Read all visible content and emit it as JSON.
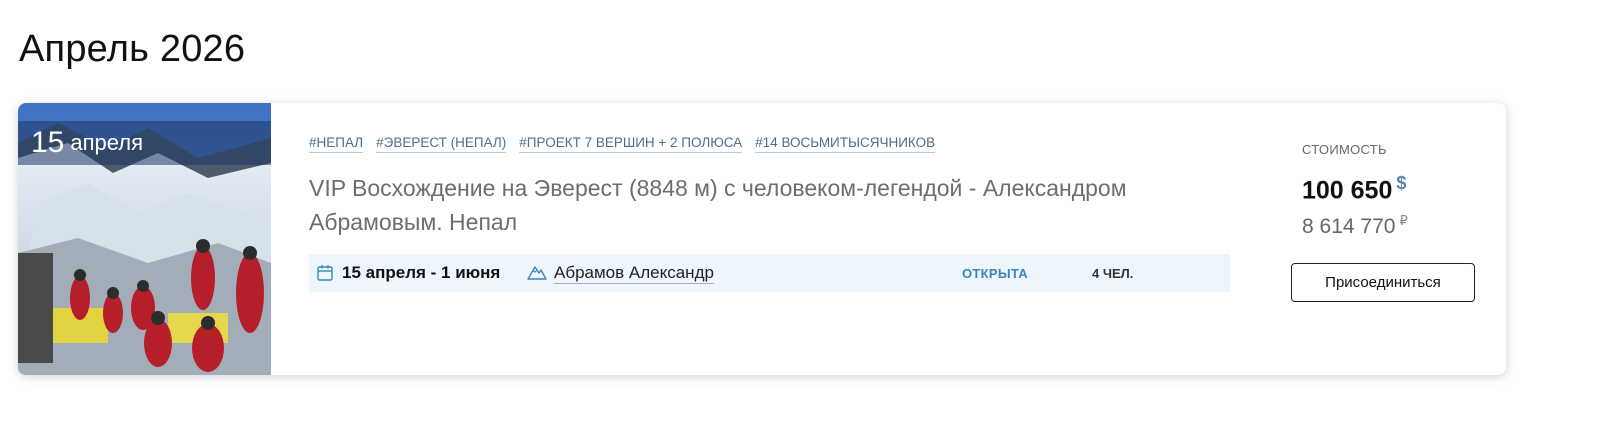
{
  "month_heading": "Апрель 2026",
  "trip": {
    "date_day": "15",
    "date_month": "апреля",
    "tags": [
      "#НЕПАЛ",
      "#ЭВЕРЕСТ (НЕПАЛ)",
      "#ПРОЕКТ 7 ВЕРШИН + 2 ПОЛЮСА",
      "#14 ВОСЬМИТЫСЯЧНИКОВ"
    ],
    "title": "VIP Восхождение на Эверест (8848 м) с человеком-легендой - Александром Абрамовым. Непал",
    "dates": "15 апреля - 1 июня",
    "guide": "Абрамов Александр",
    "status": "ОТКРЫТА",
    "people": "4 ЧЕЛ.",
    "icons": {
      "calendar": "calendar-icon",
      "mountain": "mountain-icon"
    }
  },
  "pricing": {
    "label": "СТОИМОСТЬ",
    "main_value": "100 650",
    "main_currency": "$",
    "sub_value": "8 614 770",
    "sub_currency": "₽"
  },
  "actions": {
    "join_label": "Присоединиться"
  },
  "colors": {
    "accent": "#3d86b8",
    "tag": "#4a6f8e",
    "info_bar_bg": "#eef5fc"
  }
}
